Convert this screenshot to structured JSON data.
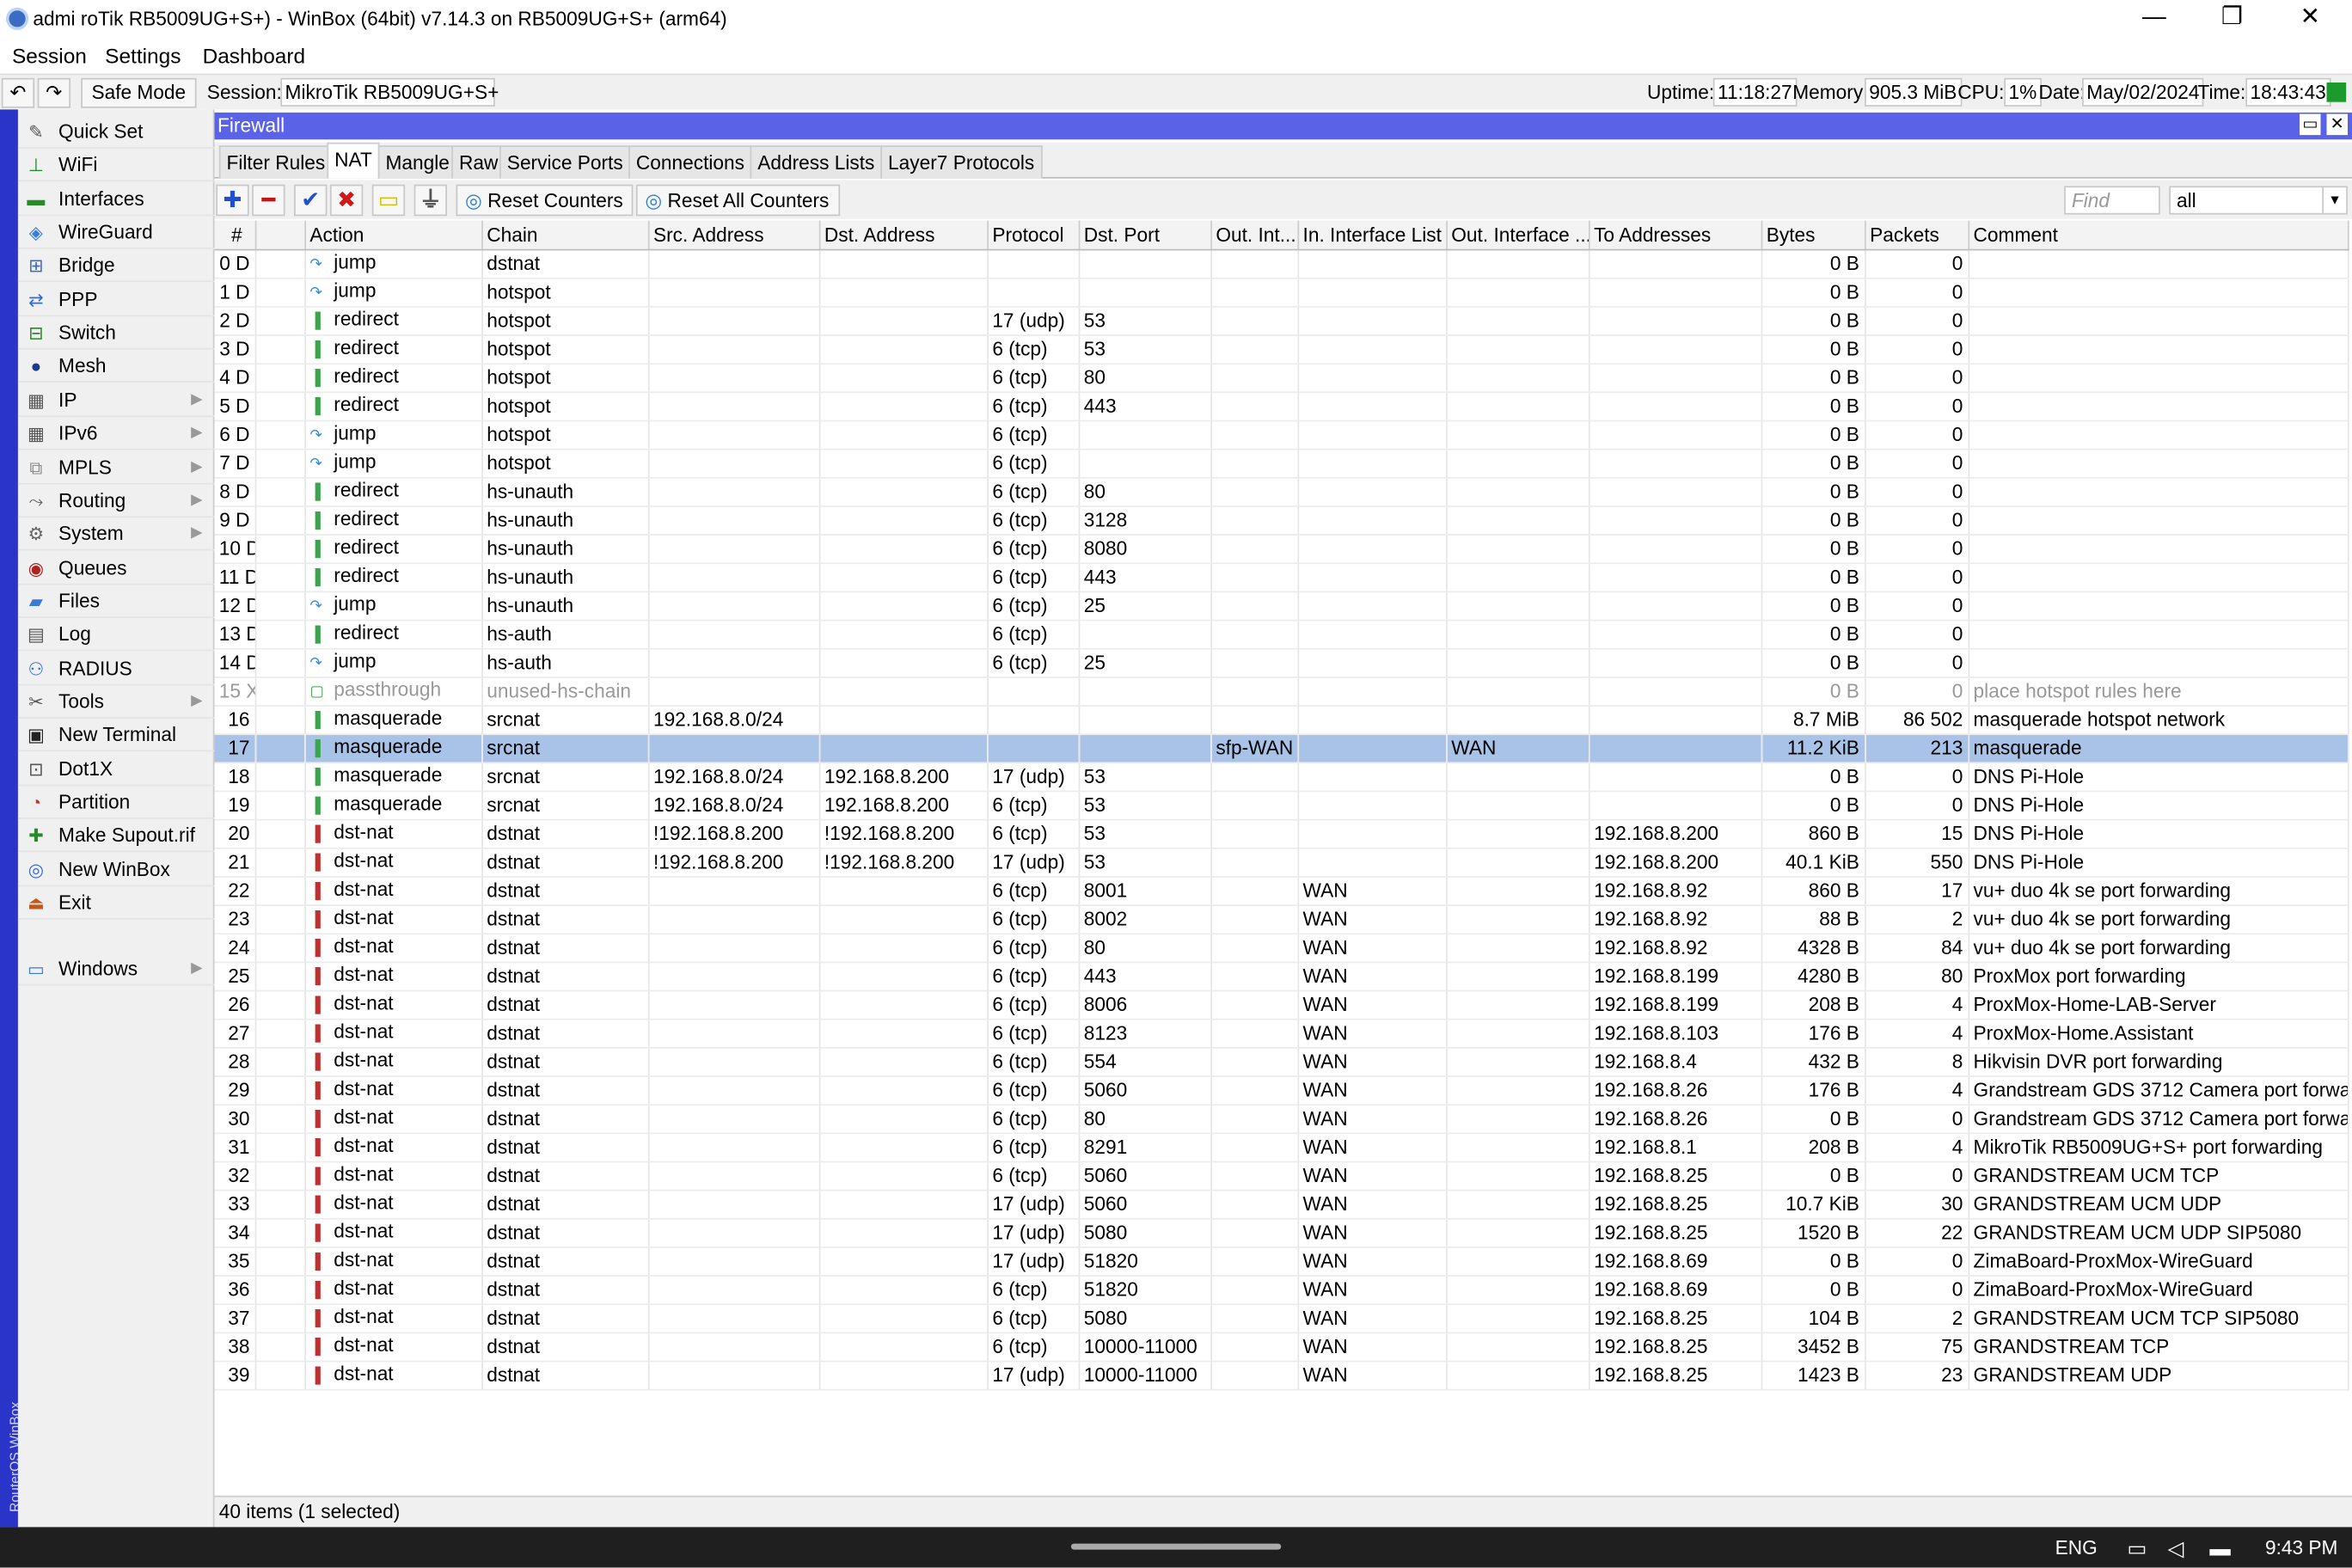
{
  "window": {
    "title": "admi                    roTik RB5009UG+S+) - WinBox (64bit) v7.14.3 on RB5009UG+S+ (arm64)"
  },
  "menu": [
    "Session",
    "Settings",
    "Dashboard"
  ],
  "toolbar": {
    "safe_mode": "Safe Mode",
    "session_label": "Session:",
    "session_value": "MikroTik RB5009UG+S+",
    "uptime_label": "Uptime:",
    "uptime": "11:18:27",
    "memory_label": "Memory:",
    "memory": "905.3 MiB",
    "cpu_label": "CPU:",
    "cpu": "1%",
    "date_label": "Date:",
    "date": "May/02/2024",
    "time_label": "Time:",
    "time": "18:43:43"
  },
  "sidebar_brand": "RouterOS WinBox",
  "sidebar": [
    {
      "label": "Quick Set",
      "icon": "wand-icon",
      "glyph": "✎",
      "sub": false
    },
    {
      "label": "WiFi",
      "icon": "antenna-icon",
      "glyph": "⊥",
      "sub": false
    },
    {
      "label": "Interfaces",
      "icon": "interfaces-icon",
      "glyph": "▬",
      "sub": false
    },
    {
      "label": "WireGuard",
      "icon": "wireguard-icon",
      "glyph": "◈",
      "sub": false
    },
    {
      "label": "Bridge",
      "icon": "bridge-icon",
      "glyph": "⊞",
      "sub": false
    },
    {
      "label": "PPP",
      "icon": "ppp-icon",
      "glyph": "⇄",
      "sub": false
    },
    {
      "label": "Switch",
      "icon": "switch-icon",
      "glyph": "⊟",
      "sub": false
    },
    {
      "label": "Mesh",
      "icon": "mesh-icon",
      "glyph": "●",
      "sub": false
    },
    {
      "label": "IP",
      "icon": "ip-icon",
      "glyph": "▦",
      "sub": true
    },
    {
      "label": "IPv6",
      "icon": "ipv6-icon",
      "glyph": "▦",
      "sub": true
    },
    {
      "label": "MPLS",
      "icon": "mpls-icon",
      "glyph": "⧉",
      "sub": true
    },
    {
      "label": "Routing",
      "icon": "routing-icon",
      "glyph": "⤳",
      "sub": true
    },
    {
      "label": "System",
      "icon": "system-icon",
      "glyph": "⚙",
      "sub": true
    },
    {
      "label": "Queues",
      "icon": "queues-icon",
      "glyph": "◉",
      "sub": false
    },
    {
      "label": "Files",
      "icon": "folder-icon",
      "glyph": "▰",
      "sub": false
    },
    {
      "label": "Log",
      "icon": "log-icon",
      "glyph": "▤",
      "sub": false
    },
    {
      "label": "RADIUS",
      "icon": "radius-icon",
      "glyph": "⚇",
      "sub": false
    },
    {
      "label": "Tools",
      "icon": "tools-icon",
      "glyph": "✂",
      "sub": true
    },
    {
      "label": "New Terminal",
      "icon": "terminal-icon",
      "glyph": "▣",
      "sub": false
    },
    {
      "label": "Dot1X",
      "icon": "dot1x-icon",
      "glyph": "⊡",
      "sub": false
    },
    {
      "label": "Partition",
      "icon": "partition-icon",
      "glyph": "◔",
      "sub": false
    },
    {
      "label": "Make Supout.rif",
      "icon": "supout-icon",
      "glyph": "✚",
      "sub": false
    },
    {
      "label": "New WinBox",
      "icon": "winbox-icon",
      "glyph": "◎",
      "sub": false
    },
    {
      "label": "Exit",
      "icon": "exit-icon",
      "glyph": "⏏",
      "sub": false
    },
    {
      "label": "Windows",
      "icon": "windows-icon",
      "glyph": "▭",
      "sub": true
    }
  ],
  "firewall": {
    "title": "Firewall",
    "tabs": [
      "Filter Rules",
      "NAT",
      "Mangle",
      "Raw",
      "Service Ports",
      "Connections",
      "Address Lists",
      "Layer7 Protocols"
    ],
    "active_tab": 1,
    "reset_counters": "Reset Counters",
    "reset_all_counters": "Reset All Counters",
    "find_placeholder": "Find",
    "filter_value": "all",
    "columns": [
      "#",
      "",
      "Action",
      "Chain",
      "Src. Address",
      "Dst. Address",
      "Protocol",
      "Dst. Port",
      "Out. Int...",
      "In. Interface List",
      "Out. Interface ...",
      "To Addresses",
      "Bytes",
      "Packets",
      "Comment"
    ],
    "rows": [
      [
        "0 D",
        "",
        "jump",
        "dstnat",
        "",
        "",
        "",
        "",
        "",
        "",
        "",
        "",
        "0 B",
        "0",
        ""
      ],
      [
        "1 D",
        "",
        "jump",
        "hotspot",
        "",
        "",
        "",
        "",
        "",
        "",
        "",
        "",
        "0 B",
        "0",
        ""
      ],
      [
        "2 D",
        "",
        "redirect",
        "hotspot",
        "",
        "",
        "17 (udp)",
        "53",
        "",
        "",
        "",
        "",
        "0 B",
        "0",
        ""
      ],
      [
        "3 D",
        "",
        "redirect",
        "hotspot",
        "",
        "",
        "6 (tcp)",
        "53",
        "",
        "",
        "",
        "",
        "0 B",
        "0",
        ""
      ],
      [
        "4 D",
        "",
        "redirect",
        "hotspot",
        "",
        "",
        "6 (tcp)",
        "80",
        "",
        "",
        "",
        "",
        "0 B",
        "0",
        ""
      ],
      [
        "5 D",
        "",
        "redirect",
        "hotspot",
        "",
        "",
        "6 (tcp)",
        "443",
        "",
        "",
        "",
        "",
        "0 B",
        "0",
        ""
      ],
      [
        "6 D",
        "",
        "jump",
        "hotspot",
        "",
        "",
        "6 (tcp)",
        "",
        "",
        "",
        "",
        "",
        "0 B",
        "0",
        ""
      ],
      [
        "7 D",
        "",
        "jump",
        "hotspot",
        "",
        "",
        "6 (tcp)",
        "",
        "",
        "",
        "",
        "",
        "0 B",
        "0",
        ""
      ],
      [
        "8 D",
        "",
        "redirect",
        "hs-unauth",
        "",
        "",
        "6 (tcp)",
        "80",
        "",
        "",
        "",
        "",
        "0 B",
        "0",
        ""
      ],
      [
        "9 D",
        "",
        "redirect",
        "hs-unauth",
        "",
        "",
        "6 (tcp)",
        "3128",
        "",
        "",
        "",
        "",
        "0 B",
        "0",
        ""
      ],
      [
        "10 D",
        "",
        "redirect",
        "hs-unauth",
        "",
        "",
        "6 (tcp)",
        "8080",
        "",
        "",
        "",
        "",
        "0 B",
        "0",
        ""
      ],
      [
        "11 D",
        "",
        "redirect",
        "hs-unauth",
        "",
        "",
        "6 (tcp)",
        "443",
        "",
        "",
        "",
        "",
        "0 B",
        "0",
        ""
      ],
      [
        "12 D",
        "",
        "jump",
        "hs-unauth",
        "",
        "",
        "6 (tcp)",
        "25",
        "",
        "",
        "",
        "",
        "0 B",
        "0",
        ""
      ],
      [
        "13 D",
        "",
        "redirect",
        "hs-auth",
        "",
        "",
        "6 (tcp)",
        "",
        "",
        "",
        "",
        "",
        "0 B",
        "0",
        ""
      ],
      [
        "14 D",
        "",
        "jump",
        "hs-auth",
        "",
        "",
        "6 (tcp)",
        "25",
        "",
        "",
        "",
        "",
        "0 B",
        "0",
        ""
      ],
      [
        "15 X",
        "",
        "passthrough",
        "unused-hs-chain",
        "",
        "",
        "",
        "",
        "",
        "",
        "",
        "",
        "0 B",
        "0",
        "place hotspot rules here"
      ],
      [
        "16",
        "",
        "masquerade",
        "srcnat",
        "192.168.8.0/24",
        "",
        "",
        "",
        "",
        "",
        "",
        "",
        "8.7 MiB",
        "86 502",
        "masquerade hotspot network"
      ],
      [
        "17",
        "",
        "masquerade",
        "srcnat",
        "",
        "",
        "",
        "",
        "sfp-WAN",
        "",
        "WAN",
        "",
        "11.2 KiB",
        "213",
        "masquerade"
      ],
      [
        "18",
        "",
        "masquerade",
        "srcnat",
        "192.168.8.0/24",
        "192.168.8.200",
        "17 (udp)",
        "53",
        "",
        "",
        "",
        "",
        "0 B",
        "0",
        "DNS Pi-Hole"
      ],
      [
        "19",
        "",
        "masquerade",
        "srcnat",
        "192.168.8.0/24",
        "192.168.8.200",
        "6 (tcp)",
        "53",
        "",
        "",
        "",
        "",
        "0 B",
        "0",
        "DNS Pi-Hole"
      ],
      [
        "20",
        "",
        "dst-nat",
        "dstnat",
        "!192.168.8.200",
        "!192.168.8.200",
        "6 (tcp)",
        "53",
        "",
        "",
        "",
        "192.168.8.200",
        "860 B",
        "15",
        "DNS Pi-Hole"
      ],
      [
        "21",
        "",
        "dst-nat",
        "dstnat",
        "!192.168.8.200",
        "!192.168.8.200",
        "17 (udp)",
        "53",
        "",
        "",
        "",
        "192.168.8.200",
        "40.1 KiB",
        "550",
        "DNS Pi-Hole"
      ],
      [
        "22",
        "",
        "dst-nat",
        "dstnat",
        "",
        "",
        "6 (tcp)",
        "8001",
        "",
        "WAN",
        "",
        "192.168.8.92",
        "860 B",
        "17",
        "vu+ duo 4k se port forwarding"
      ],
      [
        "23",
        "",
        "dst-nat",
        "dstnat",
        "",
        "",
        "6 (tcp)",
        "8002",
        "",
        "WAN",
        "",
        "192.168.8.92",
        "88 B",
        "2",
        "vu+ duo 4k se port forwarding"
      ],
      [
        "24",
        "",
        "dst-nat",
        "dstnat",
        "",
        "",
        "6 (tcp)",
        "80",
        "",
        "WAN",
        "",
        "192.168.8.92",
        "4328 B",
        "84",
        "vu+ duo 4k se port forwarding"
      ],
      [
        "25",
        "",
        "dst-nat",
        "dstnat",
        "",
        "",
        "6 (tcp)",
        "443",
        "",
        "WAN",
        "",
        "192.168.8.199",
        "4280 B",
        "80",
        "ProxMox port forwarding"
      ],
      [
        "26",
        "",
        "dst-nat",
        "dstnat",
        "",
        "",
        "6 (tcp)",
        "8006",
        "",
        "WAN",
        "",
        "192.168.8.199",
        "208 B",
        "4",
        "ProxMox-Home-LAB-Server"
      ],
      [
        "27",
        "",
        "dst-nat",
        "dstnat",
        "",
        "",
        "6 (tcp)",
        "8123",
        "",
        "WAN",
        "",
        "192.168.8.103",
        "176 B",
        "4",
        "ProxMox-Home.Assistant"
      ],
      [
        "28",
        "",
        "dst-nat",
        "dstnat",
        "",
        "",
        "6 (tcp)",
        "554",
        "",
        "WAN",
        "",
        "192.168.8.4",
        "432 B",
        "8",
        "Hikvisin DVR port forwarding"
      ],
      [
        "29",
        "",
        "dst-nat",
        "dstnat",
        "",
        "",
        "6 (tcp)",
        "5060",
        "",
        "WAN",
        "",
        "192.168.8.26",
        "176 B",
        "4",
        "Grandstream GDS 3712 Camera port forwa..."
      ],
      [
        "30",
        "",
        "dst-nat",
        "dstnat",
        "",
        "",
        "6 (tcp)",
        "80",
        "",
        "WAN",
        "",
        "192.168.8.26",
        "0 B",
        "0",
        "Grandstream GDS 3712 Camera port forwa..."
      ],
      [
        "31",
        "",
        "dst-nat",
        "dstnat",
        "",
        "",
        "6 (tcp)",
        "8291",
        "",
        "WAN",
        "",
        "192.168.8.1",
        "208 B",
        "4",
        "MikroTik RB5009UG+S+ port forwarding"
      ],
      [
        "32",
        "",
        "dst-nat",
        "dstnat",
        "",
        "",
        "6 (tcp)",
        "5060",
        "",
        "WAN",
        "",
        "192.168.8.25",
        "0 B",
        "0",
        "GRANDSTREAM UCM TCP"
      ],
      [
        "33",
        "",
        "dst-nat",
        "dstnat",
        "",
        "",
        "17 (udp)",
        "5060",
        "",
        "WAN",
        "",
        "192.168.8.25",
        "10.7 KiB",
        "30",
        "GRANDSTREAM UCM UDP"
      ],
      [
        "34",
        "",
        "dst-nat",
        "dstnat",
        "",
        "",
        "17 (udp)",
        "5080",
        "",
        "WAN",
        "",
        "192.168.8.25",
        "1520 B",
        "22",
        "GRANDSTREAM UCM UDP SIP5080"
      ],
      [
        "35",
        "",
        "dst-nat",
        "dstnat",
        "",
        "",
        "17 (udp)",
        "51820",
        "",
        "WAN",
        "",
        "192.168.8.69",
        "0 B",
        "0",
        "ZimaBoard-ProxMox-WireGuard"
      ],
      [
        "36",
        "",
        "dst-nat",
        "dstnat",
        "",
        "",
        "6 (tcp)",
        "51820",
        "",
        "WAN",
        "",
        "192.168.8.69",
        "0 B",
        "0",
        "ZimaBoard-ProxMox-WireGuard"
      ],
      [
        "37",
        "",
        "dst-nat",
        "dstnat",
        "",
        "",
        "6 (tcp)",
        "5080",
        "",
        "WAN",
        "",
        "192.168.8.25",
        "104 B",
        "2",
        "GRANDSTREAM UCM TCP SIP5080"
      ],
      [
        "38",
        "",
        "dst-nat",
        "dstnat",
        "",
        "",
        "6 (tcp)",
        "10000-11000",
        "",
        "WAN",
        "",
        "192.168.8.25",
        "3452 B",
        "75",
        "GRANDSTREAM TCP"
      ],
      [
        "39",
        "",
        "dst-nat",
        "dstnat",
        "",
        "",
        "17 (udp)",
        "10000-11000",
        "",
        "WAN",
        "",
        "192.168.8.25",
        "1423 B",
        "23",
        "GRANDSTREAM UDP"
      ]
    ],
    "selected_row": 17,
    "disabled_row": 15,
    "status": "40 items (1 selected)"
  },
  "taskbar": {
    "lang": "ENG",
    "clock": "9:43 PM"
  }
}
